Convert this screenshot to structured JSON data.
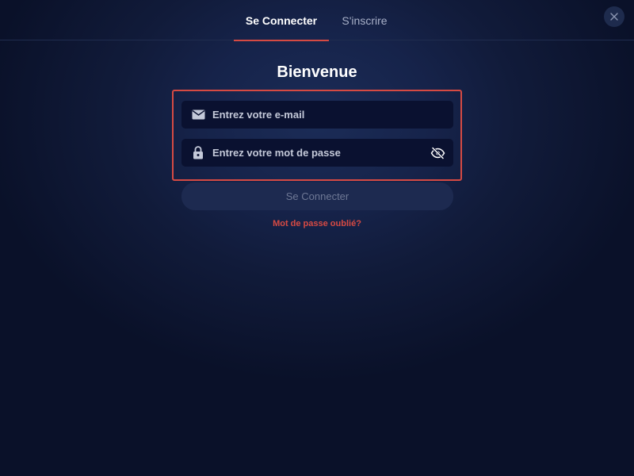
{
  "tabs": [
    {
      "label": "Se Connecter",
      "active": true
    },
    {
      "label": "S'inscrire",
      "active": false
    }
  ],
  "title": "Bienvenue",
  "form": {
    "email": {
      "placeholder": "Entrez votre e-mail",
      "value": "",
      "icon": "envelope-icon"
    },
    "password": {
      "placeholder": "Entrez votre mot de passe",
      "value": "",
      "icon": "lock-icon",
      "toggle_icon": "eye-off-icon"
    },
    "submit_label": "Se Connecter",
    "forgot_label": "Mot de passe oublié?"
  },
  "colors": {
    "accent": "#d64a43",
    "background": "#111b3a",
    "field_background": "#0a1130",
    "button_background": "#1d2a50"
  }
}
